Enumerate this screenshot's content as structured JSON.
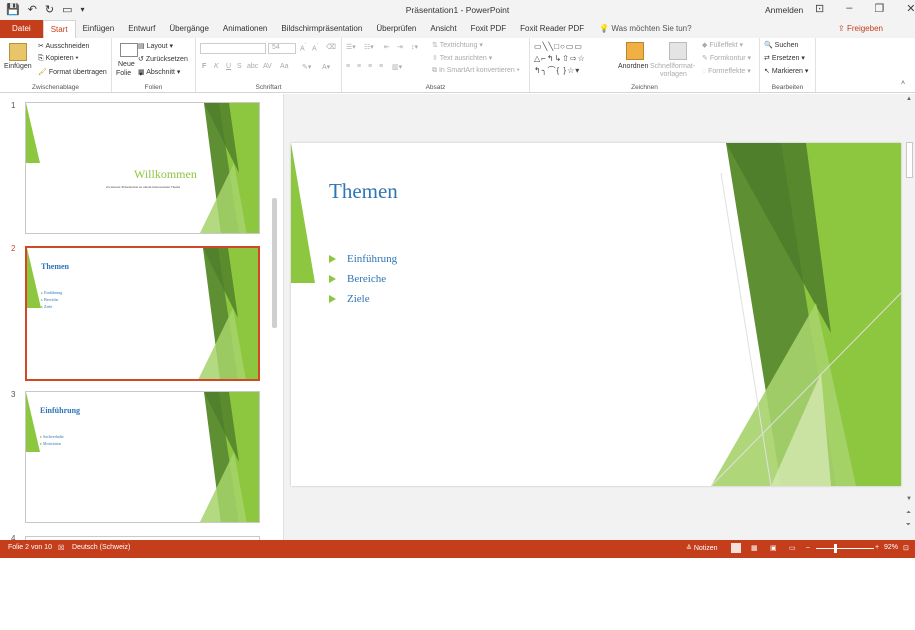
{
  "app": {
    "window_title": "Präsentation1 - PowerPoint",
    "sign_in": "Anmelden",
    "share": "Freigeben"
  },
  "tabs": [
    "Datei",
    "Start",
    "Einfügen",
    "Entwurf",
    "Übergänge",
    "Animationen",
    "Bildschirmpräsentation",
    "Überprüfen",
    "Ansicht",
    "Foxit PDF",
    "Foxit Reader PDF"
  ],
  "tell_me": "Was möchten Sie tun?",
  "ribbon": {
    "clipboard": {
      "paste": "Einfügen",
      "cut": "Ausschneiden",
      "copy": "Kopieren",
      "format_painter": "Format übertragen",
      "label": "Zwischenablage"
    },
    "slides": {
      "new_slide_1": "Neue",
      "new_slide_2": "Folie",
      "layout": "Layout",
      "reset": "Zurücksetzen",
      "section": "Abschnitt",
      "label": "Folien"
    },
    "font": {
      "font_size": "54",
      "bold": "F",
      "italic": "K",
      "underline": "U",
      "strike": "S",
      "shadow": "abc",
      "spacing": "AV",
      "case": "Aa",
      "label": "Schriftart"
    },
    "paragraph": {
      "text_direction": "Textrichtung",
      "align_text": "Text ausrichten",
      "smartart": "In SmartArt konvertieren",
      "label": "Absatz"
    },
    "drawing": {
      "arrange": "Anordnen",
      "quick_styles_1": "Schnellformat-",
      "quick_styles_2": "vorlagen",
      "fill": "Fülleffekt",
      "outline": "Formkontur",
      "effects": "Formeffekte",
      "label": "Zeichnen"
    },
    "editing": {
      "find": "Suchen",
      "replace": "Ersetzen",
      "select": "Markieren",
      "label": "Bearbeiten"
    }
  },
  "thumbnails": [
    {
      "num": "1",
      "title": "Willkommen",
      "subtitle": "Zu unserer Präsentation zu einem interessanten Thema",
      "items": []
    },
    {
      "num": "2",
      "title": "Themen",
      "items": [
        "Einführung",
        "Bereiche",
        "Ziele"
      ]
    },
    {
      "num": "3",
      "title": "Einführung",
      "items": [
        "Sachverhalte",
        "Motivation"
      ]
    },
    {
      "num": "4"
    }
  ],
  "slide": {
    "title": "Themen",
    "bullets": [
      "Einführung",
      "Bereiche",
      "Ziele"
    ]
  },
  "status": {
    "slide_counter": "Folie 2 von 10",
    "language": "Deutsch (Schweiz)",
    "notes": "Notizen",
    "zoom": "92%"
  },
  "colors": {
    "accent": "#c43e1c",
    "title_blue": "#2e75b6",
    "green": "#8dc63f"
  }
}
